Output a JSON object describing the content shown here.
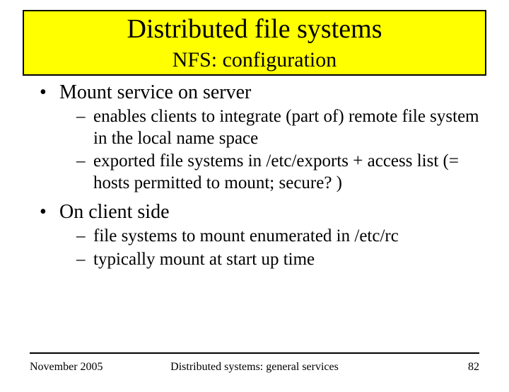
{
  "header": {
    "title": "Distributed file systems",
    "subtitle": "NFS: configuration"
  },
  "body": {
    "b1": "Mount service on server",
    "b1s1": "enables clients to integrate (part of) remote file system in the local name space",
    "b1s2": "exported file systems in /etc/exports + access list (= hosts permitted to mount; secure? )",
    "b2": "On client side",
    "b2s1": "file systems to mount enumerated in /etc/rc",
    "b2s2": "typically mount at start up time"
  },
  "footer": {
    "date": "November 2005",
    "center": "Distributed systems: general services",
    "page": "82"
  }
}
